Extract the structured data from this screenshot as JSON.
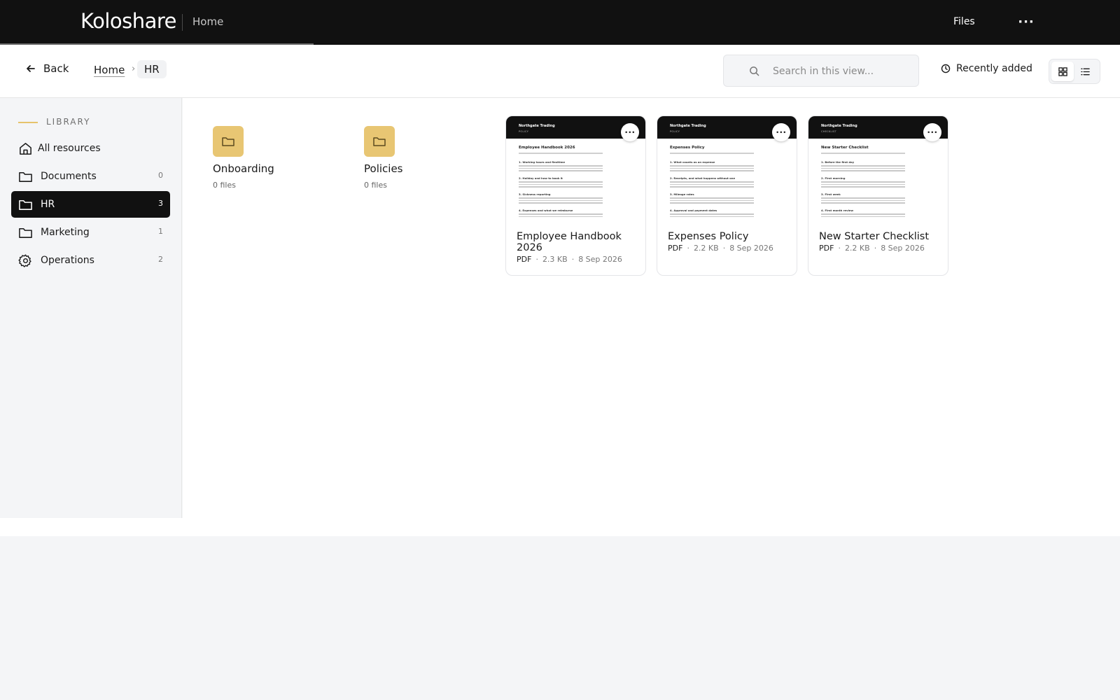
{
  "app": {
    "logo_text": "Koloshare",
    "section": "Home",
    "nav_files": "Files",
    "nav_more": "···"
  },
  "toolbar": {
    "back_label": "Back",
    "breadcrumb_home": "Home",
    "breadcrumb_sep": "›",
    "breadcrumb_current": "HR",
    "search_placeholder": "Search in this view...",
    "sort_label": "Recently added"
  },
  "sidebar": {
    "section_label": "LIBRARY",
    "items": [
      {
        "label": "All resources",
        "count": "",
        "icon": "home-icon"
      },
      {
        "label": "Documents",
        "count": "0",
        "icon": "folder-icon"
      },
      {
        "label": "HR",
        "count": "3",
        "icon": "folder-icon",
        "active": true
      },
      {
        "label": "Marketing",
        "count": "1",
        "icon": "folder-icon"
      },
      {
        "label": "Operations",
        "count": "2",
        "icon": "gear-icon"
      }
    ]
  },
  "folders": [
    {
      "name": "Onboarding",
      "count": "0 files"
    },
    {
      "name": "Policies",
      "count": "0 files"
    }
  ],
  "files": [
    {
      "title": "Employee Handbook 2026",
      "type": "PDF",
      "size": "2.3 KB",
      "date": "8 Sep 2026",
      "thumb": {
        "brand": "Northgate Trading",
        "kind": "POLICY",
        "title": "Employee Handbook 2026",
        "sections": [
          "1. Working hours and flexitime",
          "2. Holiday and how to book it",
          "3. Sickness reporting",
          "4. Expenses and what we reimburse"
        ]
      }
    },
    {
      "title": "Expenses Policy",
      "type": "PDF",
      "size": "2.2 KB",
      "date": "8 Sep 2026",
      "thumb": {
        "brand": "Northgate Trading",
        "kind": "POLICY",
        "title": "Expenses Policy",
        "sections": [
          "1. What counts as an expense",
          "2. Receipts, and what happens without one",
          "3. Mileage rates",
          "4. Approval and payment dates"
        ]
      }
    },
    {
      "title": "New Starter Checklist",
      "type": "PDF",
      "size": "2.2 KB",
      "date": "8 Sep 2026",
      "thumb": {
        "brand": "Northgate Trading",
        "kind": "CHECKLIST",
        "title": "New Starter Checklist",
        "sections": [
          "1. Before the first day",
          "2. First morning",
          "3. First week",
          "4. First month review"
        ]
      }
    }
  ],
  "meta_sep": "·",
  "colors": {
    "accent": "#e8c673",
    "dark": "#111111",
    "background": "#f4f5f7"
  }
}
